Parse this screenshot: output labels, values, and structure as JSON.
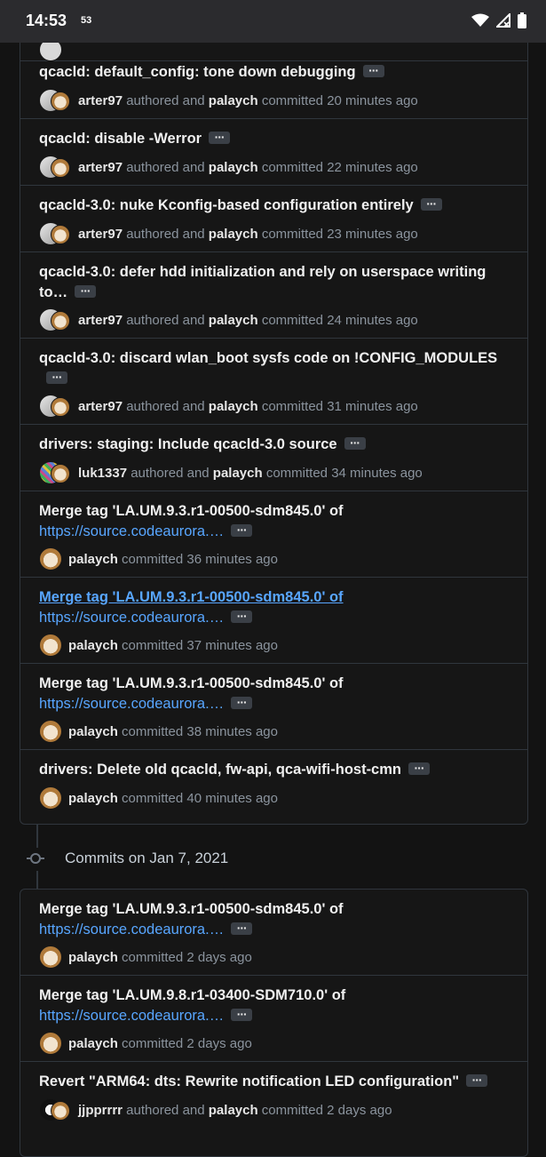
{
  "status_bar": {
    "time": "14:53",
    "badge": "53",
    "icons": [
      "wifi-icon",
      "signal-icon",
      "battery-icon"
    ]
  },
  "colors": {
    "background": "#131313",
    "link": "#58a6ff",
    "border": "#30363d",
    "muted": "#8b949e"
  },
  "group1": {
    "commits": [
      {
        "title": "qcacld: default_config: tone down debugging",
        "author": "arter97",
        "committer": "palaych",
        "time": "20 minutes ago"
      },
      {
        "title": "qcacld: disable -Werror",
        "author": "arter97",
        "committer": "palaych",
        "time": "22 minutes ago"
      },
      {
        "title": "qcacld-3.0: nuke Kconfig-based configuration entirely",
        "author": "arter97",
        "committer": "palaych",
        "time": "23 minutes ago"
      },
      {
        "title": "qcacld-3.0: defer hdd initialization and rely on userspace writing to…",
        "author": "arter97",
        "committer": "palaych",
        "time": "24 minutes ago"
      },
      {
        "title": "qcacld-3.0: discard wlan_boot sysfs code on !CONFIG_MODULES",
        "author": "arter97",
        "committer": "palaych",
        "time": "31 minutes ago"
      },
      {
        "title": "drivers: staging: Include qcacld-3.0 source",
        "author": "luk1337",
        "committer": "palaych",
        "time": "34 minutes ago"
      },
      {
        "title": "Merge tag 'LA.UM.9.3.r1-00500-sdm845.0' of",
        "link": "https://source.codeaurora.…",
        "committer": "palaych",
        "time": "36 minutes ago"
      },
      {
        "title": "Merge tag 'LA.UM.9.3.r1-00500-sdm845.0' of",
        "link": "https://source.codeaurora.…",
        "committer": "palaych",
        "time": "37 minutes ago"
      },
      {
        "title": "Merge tag 'LA.UM.9.3.r1-00500-sdm845.0' of",
        "link": "https://source.codeaurora.…",
        "committer": "palaych",
        "time": "38 minutes ago"
      },
      {
        "title": "drivers: Delete old qcacld, fw-api, qca-wifi-host-cmn",
        "committer": "palaych",
        "time": "40 minutes ago"
      }
    ]
  },
  "group2": {
    "header": "Commits on Jan 7, 2021",
    "commits": [
      {
        "title": "Merge tag 'LA.UM.9.3.r1-00500-sdm845.0' of",
        "link": "https://source.codeaurora.…",
        "committer": "palaych",
        "time": "2 days ago"
      },
      {
        "title": "Merge tag 'LA.UM.9.8.r1-03400-SDM710.0' of",
        "link": "https://source.codeaurora.…",
        "committer": "palaych",
        "time": "2 days ago"
      },
      {
        "title": "Revert \"ARM64: dts: Rewrite notification LED configuration\"",
        "author": "jjpprrrr",
        "committer": "palaych",
        "time": "2 days ago"
      }
    ]
  },
  "labels": {
    "authored_and": " authored and ",
    "committed": " committed "
  }
}
